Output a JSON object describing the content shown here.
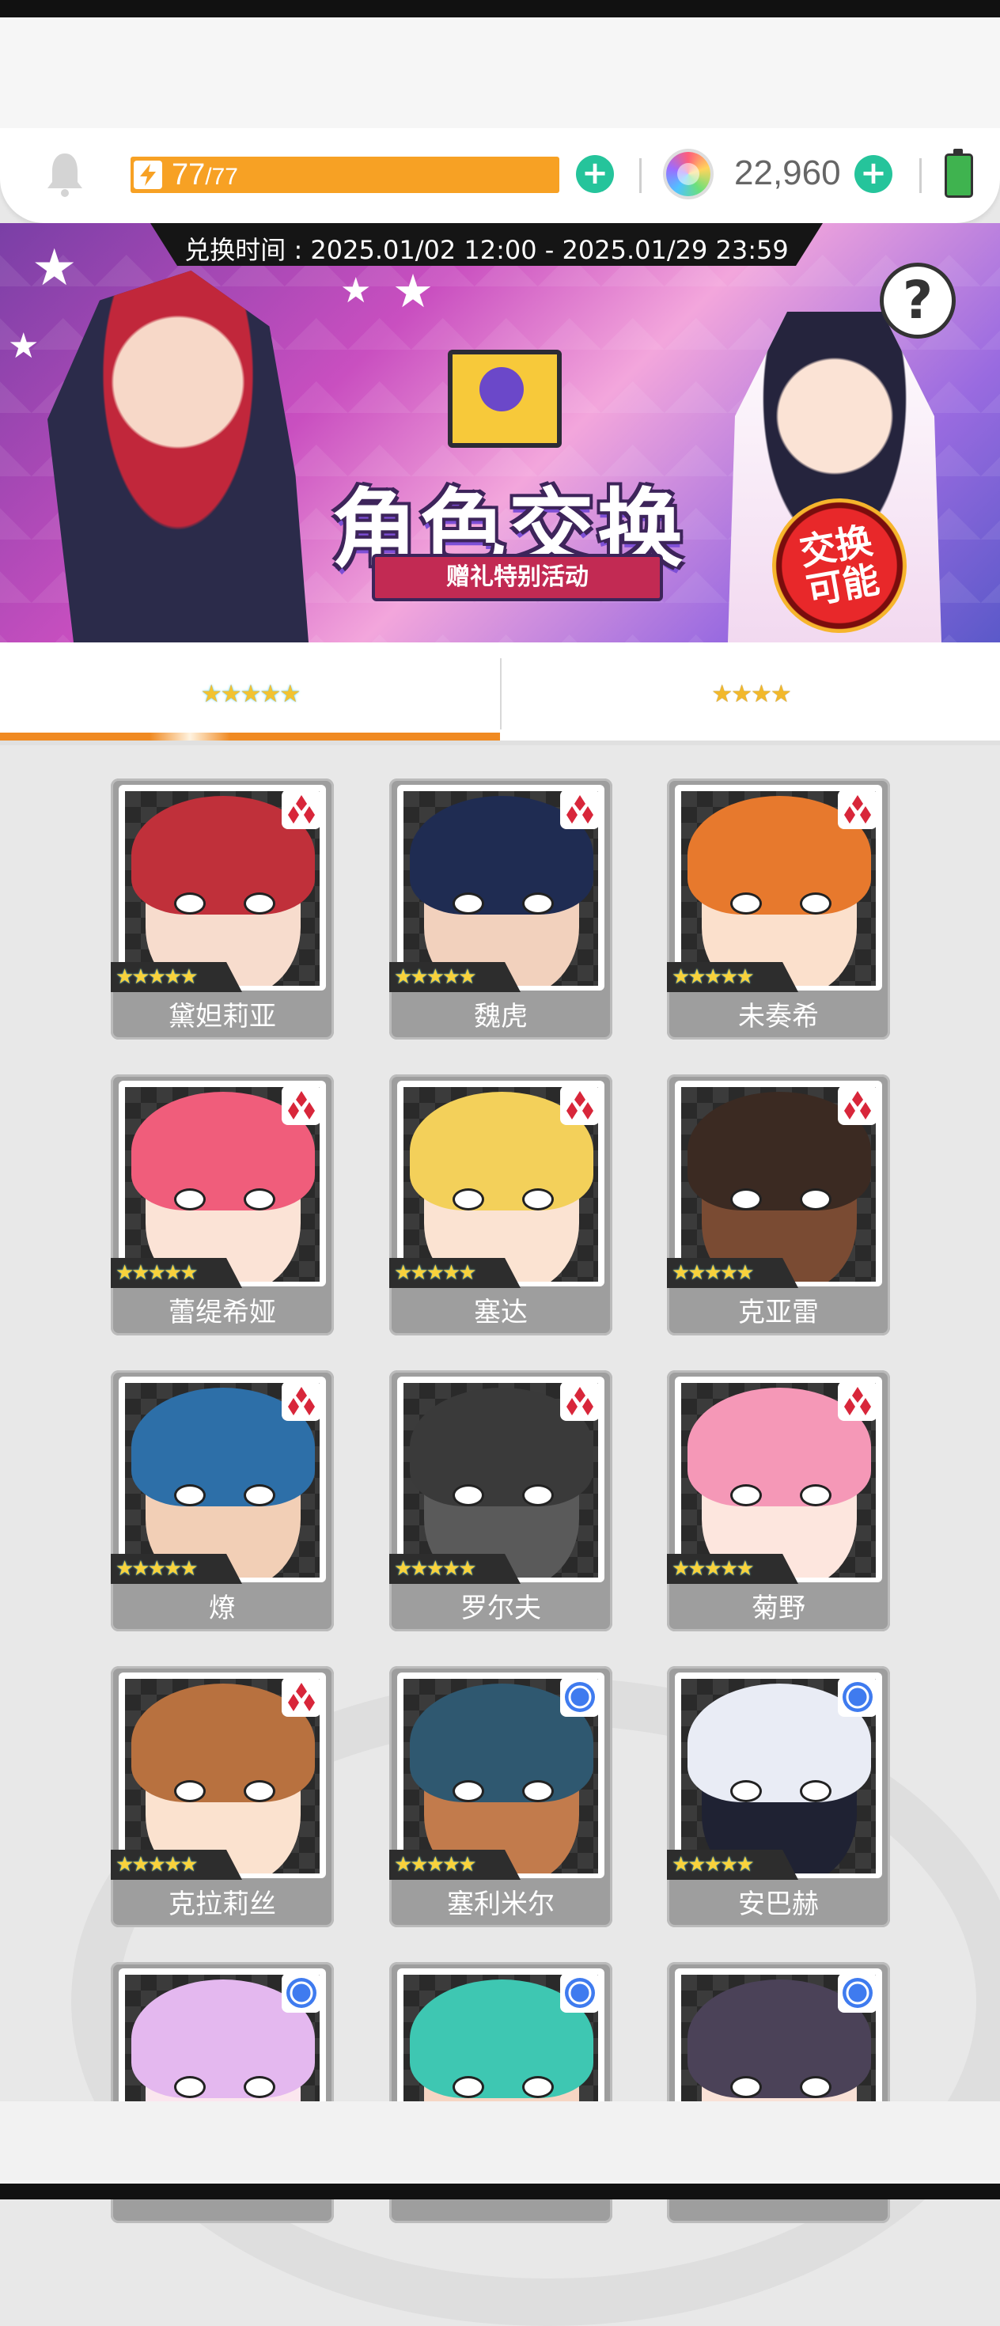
{
  "status": {
    "stamina_current": "77",
    "stamina_max": "/77",
    "gems": "22,960"
  },
  "banner": {
    "period": "兑换时间 : 2025.01/02 12:00 - 2025.01/29 23:59",
    "title": "角色交换",
    "subtitle": "赠礼特别活动",
    "badge_line1": "交换",
    "badge_line2": "可能",
    "help": "?"
  },
  "tabs": [
    {
      "label": "★★★★★",
      "rarity": 5,
      "active": true
    },
    {
      "label": "★★★★",
      "rarity": 4,
      "active": false
    }
  ],
  "characters": [
    {
      "name": "黛妲莉亚",
      "stars": "★★★★★",
      "type": "diamond",
      "hair": "#c0303a",
      "skin": "#f7dccd"
    },
    {
      "name": "魏虎",
      "stars": "★★★★★",
      "type": "diamond",
      "hair": "#1f2c52",
      "skin": "#f2d1bd"
    },
    {
      "name": "未奏希",
      "stars": "★★★★★",
      "type": "diamond",
      "hair": "#e7792d",
      "skin": "#fbe0cc"
    },
    {
      "name": "蕾缇希娅",
      "stars": "★★★★★",
      "type": "diamond",
      "hair": "#f05d7b",
      "skin": "#fbe3d6"
    },
    {
      "name": "塞达",
      "stars": "★★★★★",
      "type": "diamond",
      "hair": "#f3d05a",
      "skin": "#fbe3d2"
    },
    {
      "name": "克亚雷",
      "stars": "★★★★★",
      "type": "diamond",
      "hair": "#3b2a22",
      "skin": "#7a4b33"
    },
    {
      "name": "燎",
      "stars": "★★★★★",
      "type": "diamond",
      "hair": "#2d6fa8",
      "skin": "#f2cfb6"
    },
    {
      "name": "罗尔夫",
      "stars": "★★★★★",
      "type": "diamond",
      "hair": "#3a3a3a",
      "skin": "#5a5a5a"
    },
    {
      "name": "菊野",
      "stars": "★★★★★",
      "type": "diamond",
      "hair": "#f598b7",
      "skin": "#fde6de"
    },
    {
      "name": "克拉莉丝",
      "stars": "★★★★★",
      "type": "diamond",
      "hair": "#b8713f",
      "skin": "#fbe2cf"
    },
    {
      "name": "塞利米尔",
      "stars": "★★★★★",
      "type": "circle",
      "hair": "#2f5870",
      "skin": "#c27b4c"
    },
    {
      "name": "安巴赫",
      "stars": "★★★★★",
      "type": "circle",
      "hair": "#e9ecf5",
      "skin": "#1f2233"
    },
    {
      "name": "",
      "stars": "",
      "type": "circle",
      "hair": "#e4b8ef",
      "skin": "#fbe6ee"
    },
    {
      "name": "",
      "stars": "",
      "type": "circle",
      "hair": "#3ec7b2",
      "skin": "#f6d5c3"
    },
    {
      "name": "",
      "stars": "",
      "type": "circle",
      "hair": "#4b4258",
      "skin": "#f9e1d6"
    }
  ],
  "colors": {
    "accent_orange": "#f7a124",
    "plus_green": "#25c49b",
    "badge_red": "#d8263a",
    "badge_blue": "#3f7bef"
  }
}
